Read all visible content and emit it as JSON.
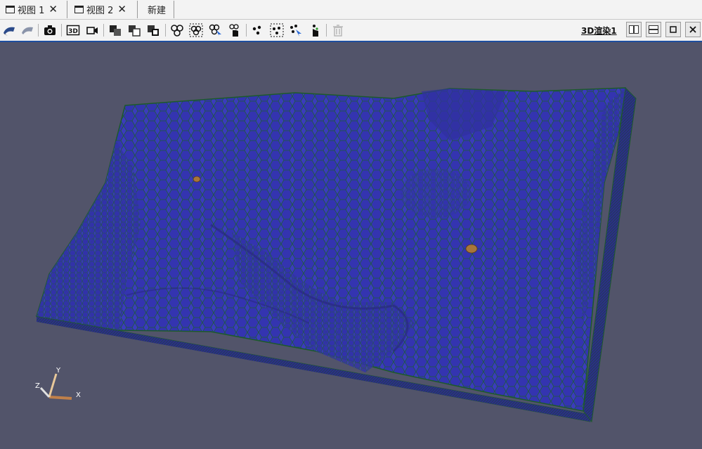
{
  "tabs": [
    {
      "label": "视图 1",
      "close": "✕"
    },
    {
      "label": "视图 2",
      "close": "✕"
    },
    {
      "label": "新建"
    }
  ],
  "toolbar": {
    "render_view_label": "3D渲染1",
    "icons": [
      "camera-reset-icon",
      "camera-flip-icon",
      "screenshot-icon",
      "3d-toggle-icon",
      "record-icon",
      "split-select-icon",
      "copy-icon",
      "paste-icon",
      "select-cells-icon",
      "select-cells-frustum-icon",
      "select-cells-interactive-icon",
      "hand-pick-icon",
      "select-points-icon",
      "select-points-frustum-icon",
      "select-points-interactive-icon",
      "hand-point-icon",
      "delete-icon"
    ]
  },
  "axes": {
    "x": "X",
    "y": "Y",
    "z": "Z"
  },
  "colors": {
    "background": "#52546a",
    "mesh": "#3a3ab8",
    "edge": "#1a6b2a",
    "accent": "#1f4f9f"
  }
}
